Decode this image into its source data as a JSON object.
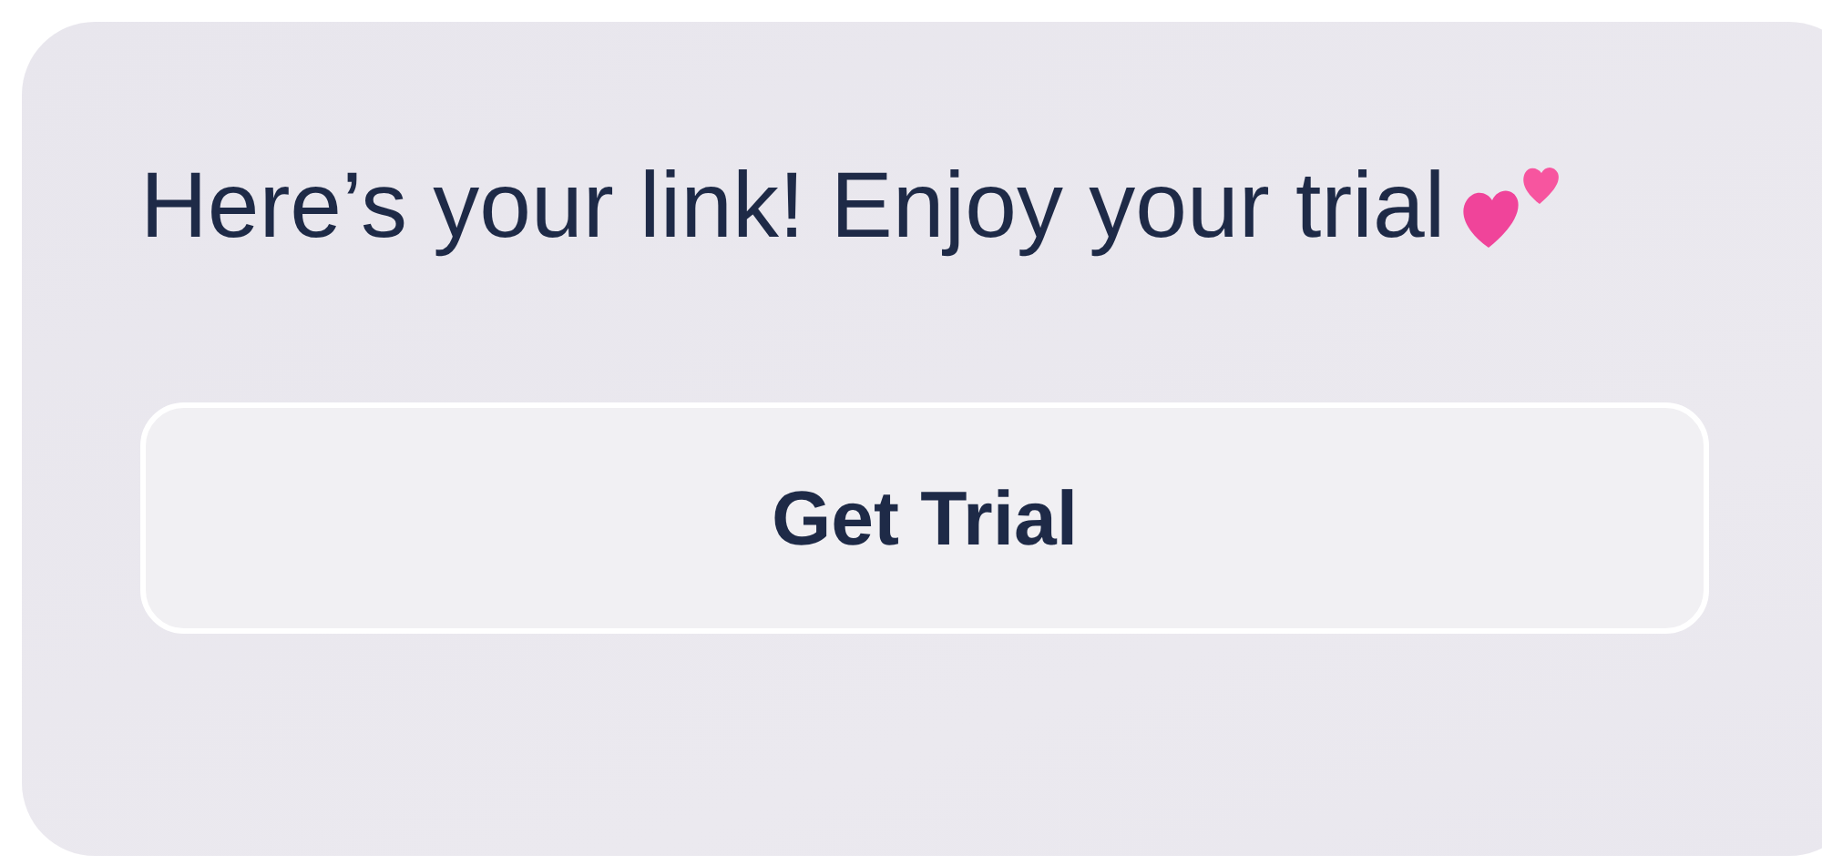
{
  "message": {
    "text": "Here’s your link! Enjoy your trial"
  },
  "button": {
    "label": "Get Trial"
  }
}
